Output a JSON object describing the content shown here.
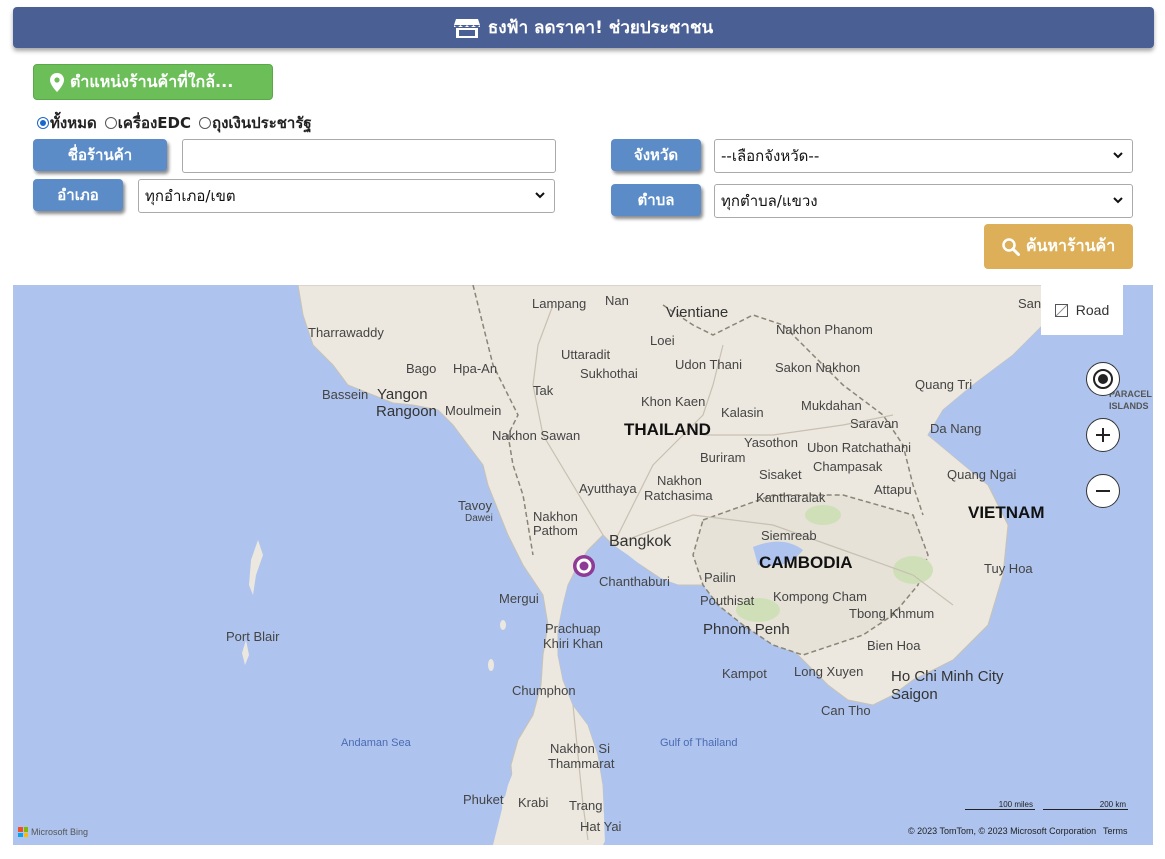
{
  "header": {
    "title": "ธงฟ้า ลดราคา! ช่วยประชาชน",
    "icon": "store-icon"
  },
  "nearby_button": {
    "label": "ตำแหน่งร้านค้าที่ใกล้...",
    "icon": "map-pin-icon"
  },
  "filters": {
    "radios": [
      {
        "label": "ทั้งหมด",
        "checked": true
      },
      {
        "label": "เครื่องEDC",
        "checked": false
      },
      {
        "label": "ถุงเงินประชารัฐ",
        "checked": false
      }
    ],
    "shop_name_label": "ชื่อร้านค้า",
    "shop_name_value": "",
    "province_label": "จังหวัด",
    "province_value": "--เลือกจังหวัด--",
    "district_label": "อำเภอ",
    "district_value": "ทุกอำเภอ/เขต",
    "subdistrict_label": "ตำบล",
    "subdistrict_value": "ทุกตำบล/แขวง",
    "search_button": "ค้นหาร้านค้า"
  },
  "map": {
    "mode_label": "Road",
    "labels": {
      "countries": [
        "THAILAND",
        "CAMBODIA",
        "VIETNAM"
      ],
      "cities": [
        "Lampang",
        "Nan",
        "Vientiane",
        "Nakhon Phanom",
        "Tharrawaddy",
        "Uttaradit",
        "Loei",
        "Udon Thani",
        "Sakon Nakhon",
        "Bago",
        "Hpa-An",
        "Sukhothai",
        "Bassein",
        "Yangon",
        "Rangoon",
        "Tak",
        "Khon Kaen",
        "Kalasin",
        "Mukdahan",
        "Quang Tri",
        "Moulmein",
        "Nakhon Sawan",
        "Saravan",
        "Da Nang",
        "Yasothon",
        "Ubon Ratchathani",
        "Buriram",
        "Champasak",
        "Sisaket",
        "Quang Ngai",
        "Ayutthaya",
        "Nakhon",
        "Ratchasima",
        "Attapu",
        "Kantharalak",
        "Tavoy",
        "Dawei",
        "Nakhon",
        "Pathom",
        "Siemreab",
        "Bangkok",
        "Chanthaburi",
        "Pailin",
        "Tuy Hoa",
        "Mergui",
        "Pouthisat",
        "Kompong Cham",
        "Tbong Khmum",
        "Phnom Penh",
        "Port Blair",
        "Prachuap",
        "Khiri Khan",
        "Bien Hoa",
        "Kampot",
        "Long Xuyen",
        "Ho Chi Minh City",
        "Saigon",
        "Chumphon",
        "Can Tho",
        "Nakhon Si",
        "Thammarat",
        "Phuket",
        "Krabi",
        "Trang",
        "Hat Yai",
        "San",
        "PARACEL",
        "ISLANDS"
      ],
      "seas": [
        "Andaman Sea",
        "Gulf of Thailand"
      ]
    },
    "scale": {
      "miles": "100 miles",
      "km": "200 km"
    },
    "attribution": "© 2023 TomTom, © 2023 Microsoft Corporation",
    "terms": "Terms",
    "brand": "Microsoft Bing"
  }
}
